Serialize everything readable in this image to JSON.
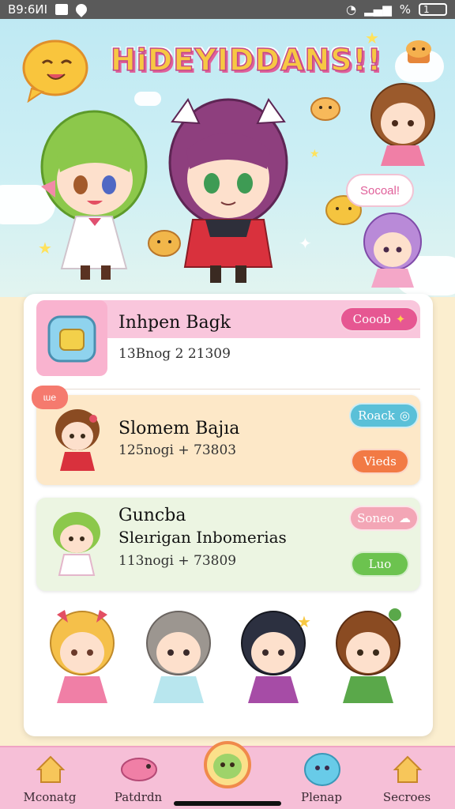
{
  "status_bar": {
    "time": "B9:6ИI",
    "right_text": "%",
    "battery": "1"
  },
  "header": {
    "app_title": "HiDEYIDDANS!!",
    "speech_bubble": "Socoal!"
  },
  "list": [
    {
      "title": "Inhpen Bagk",
      "subtitle": "13Bnog 2 21309",
      "button": "Cooob",
      "button_color": "#e65792"
    },
    {
      "tag": "ɩue",
      "title": "Slomem Bajıa",
      "subtitle": "125nogi + 73803",
      "buttons": [
        {
          "label": "Roack",
          "color": "#5ac0d8"
        },
        {
          "label": "Vieds",
          "color": "#f27a45"
        }
      ]
    },
    {
      "title": "Guncba",
      "title2": "Sleırigan Inbomerias",
      "subtitle": "113nogi + 73809",
      "buttons": [
        {
          "label": "Soneo",
          "color": "#f3a6b6"
        },
        {
          "label": "Luo",
          "color": "#6cc34f"
        }
      ]
    }
  ],
  "nav": [
    {
      "label": "Mconatg",
      "icon": "house-icon"
    },
    {
      "label": "Patdrdn",
      "icon": "bird-icon"
    },
    {
      "label": "",
      "icon": "center-character-icon"
    },
    {
      "label": "Plenap",
      "icon": "bubble-character-icon"
    },
    {
      "label": "Secroes",
      "icon": "house-icon"
    }
  ],
  "colors": {
    "accent_pink": "#f6bfd7",
    "sky": "#bfe9f3",
    "card_peach": "#fde8c8",
    "card_green": "#ecf5e2"
  }
}
